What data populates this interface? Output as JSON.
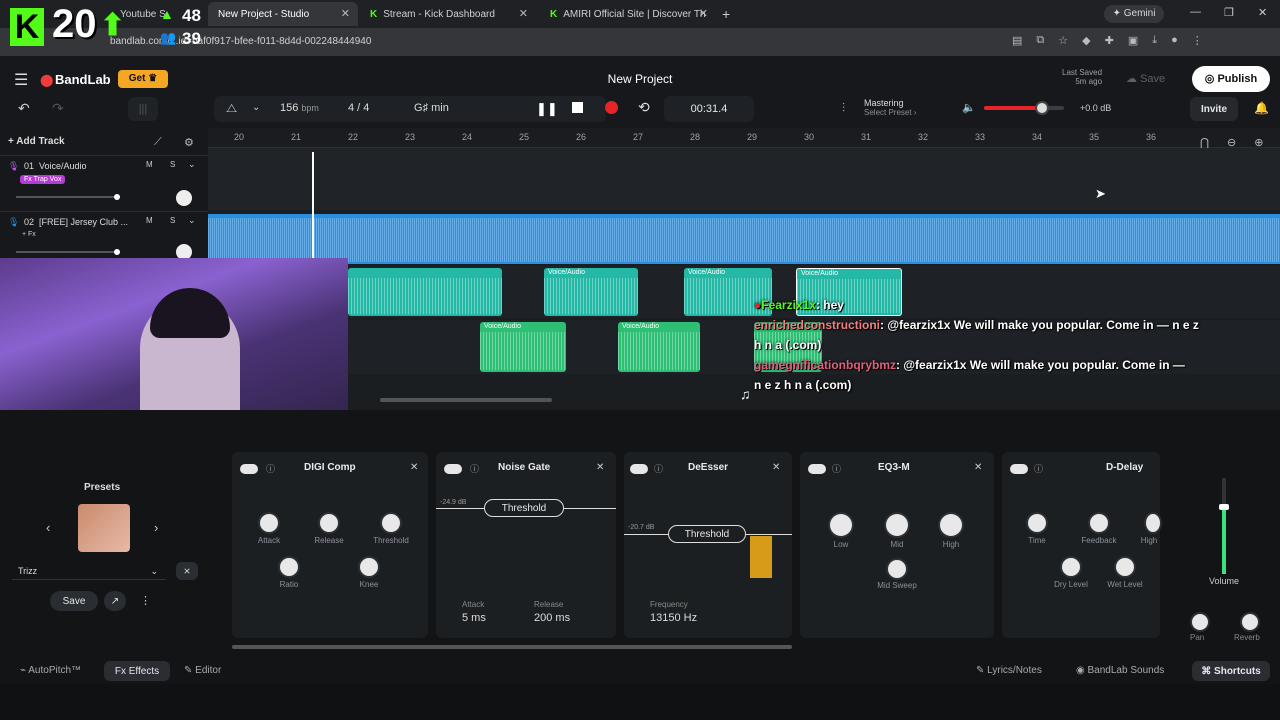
{
  "overlay": {
    "logo_letter": "K",
    "big_count": "20",
    "count_up": "48",
    "count_down": "39"
  },
  "browser": {
    "tabs": [
      {
        "label": "Youtube S"
      },
      {
        "label": "New Project - Studio"
      },
      {
        "label": "Stream - Kick Dashboard"
      },
      {
        "label": "AMIRI Official Site | Discover Th"
      }
    ],
    "gemini": "Gemini",
    "url": "bandlab.com/...id=baf0f917-bfee-f011-8d4d-002248444940"
  },
  "header": {
    "brand": "BandLab",
    "get_label": "Get",
    "project_title": "New Project",
    "last_saved_label": "Last Saved",
    "last_saved_time": "5m ago",
    "save_label": "Save",
    "publish_label": "Publish",
    "invite_label": "Invite"
  },
  "transport": {
    "bpm": "156",
    "bpm_unit": "bpm",
    "time_sig": "4 / 4",
    "key": "G♯ min",
    "time": "00:31.4",
    "mastering_title": "Mastering",
    "mastering_sub": "Select Preset ›",
    "db": "+0.0 dB",
    "volume": 0.72
  },
  "ruler": [
    "20",
    "21",
    "22",
    "23",
    "24",
    "25",
    "26",
    "27",
    "28",
    "29",
    "30",
    "31",
    "32",
    "33",
    "34",
    "35",
    "36"
  ],
  "tracks": [
    {
      "num": "01",
      "name": "Voice/Audio",
      "tag": "Fx Trap Vox",
      "mute": "M",
      "solo": "S"
    },
    {
      "num": "02",
      "name": "[FREE] Jersey Club ...",
      "tag": "+ Fx",
      "mute": "M",
      "solo": "S"
    }
  ],
  "add_track": "Add Track",
  "clip_label": "Voice/Audio",
  "chat": [
    {
      "user": "Fearzix1x",
      "msg": ": hey"
    },
    {
      "user": "enrichedconstructioni",
      "msg": ": @fearzix1x We will make you popular. Come in — n e z"
    },
    {
      "user": "",
      "msg": "h n a (.com)"
    },
    {
      "user": "gamegnificationbqrybmz",
      "msg": ": @fearzix1x We will make you popular. Come in —"
    },
    {
      "user": "",
      "msg": "n e z h n a (.com)"
    }
  ],
  "presets": {
    "title": "Presets",
    "selected": "Trizz",
    "save": "Save"
  },
  "fx": {
    "digi": {
      "title": "DIGI Comp",
      "knobs": [
        "Attack",
        "Release",
        "Threshold",
        "Ratio",
        "Knee"
      ]
    },
    "gate": {
      "title": "Noise Gate",
      "threshold": "Threshold",
      "db": "-24.9 dB",
      "attack_label": "Attack",
      "attack": "5 ms",
      "release_label": "Release",
      "release": "200 ms"
    },
    "deesser": {
      "title": "DeEsser",
      "threshold": "Threshold",
      "db": "-20.7 dB",
      "freq_label": "Frequency",
      "freq": "13150 Hz"
    },
    "eq": {
      "title": "EQ3-M",
      "knobs": [
        "Low",
        "Mid",
        "High",
        "Mid Sweep"
      ]
    },
    "delay": {
      "title": "D-Delay",
      "knobs": [
        "Time",
        "Feedback",
        "High",
        "Dry Level",
        "Wet Level"
      ]
    }
  },
  "right_panel": {
    "volume": "Volume",
    "pan": "Pan",
    "reverb": "Reverb"
  },
  "bottom": {
    "autopitch": "AutoPitch™",
    "effects": "Effects",
    "editor": "Editor",
    "lyrics": "Lyrics/Notes",
    "sounds": "BandLab Sounds",
    "shortcuts": "Shortcuts"
  }
}
